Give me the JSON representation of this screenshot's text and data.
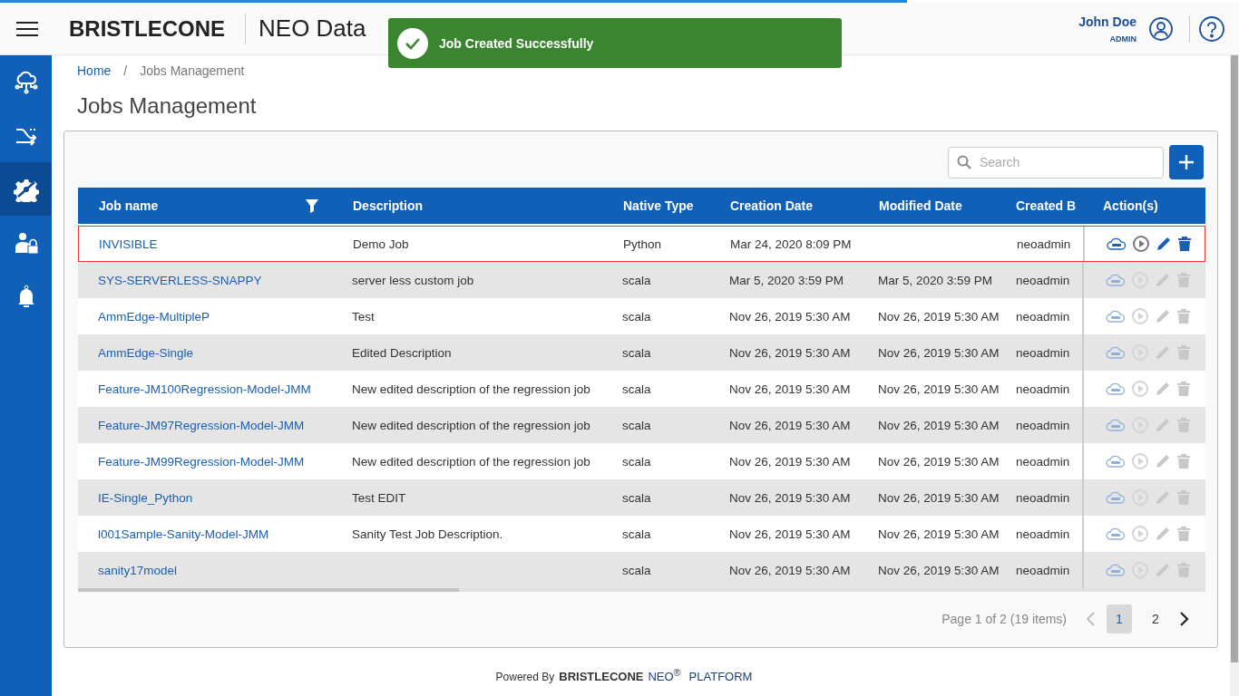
{
  "header": {
    "brand": "BRISTLECONE",
    "app_title": "NEO Data",
    "user": {
      "name": "John Doe",
      "role": "ADMIN"
    }
  },
  "toast": {
    "message": "Job Created Successfully"
  },
  "sidebar": {
    "items": [
      {
        "selected": false
      },
      {
        "selected": false
      },
      {
        "selected": true
      },
      {
        "selected": false
      },
      {
        "selected": false
      }
    ]
  },
  "breadcrumb": [
    {
      "label": "Home",
      "kind": "link"
    },
    {
      "label": "/",
      "kind": "separator"
    },
    {
      "label": "Jobs Management",
      "kind": "current"
    }
  ],
  "page_title": "Jobs Management",
  "search": {
    "placeholder": "Search"
  },
  "table": {
    "columns": [
      "Job name",
      "Description",
      "Native Type",
      "Creation Date",
      "Modified Date",
      "Created B",
      "Action(s)"
    ],
    "rows": [
      {
        "cells": [
          "INVISIBLE",
          "Demo Job",
          "Python",
          "Mar 24, 2020 8:09 PM",
          "",
          "neoadmin"
        ],
        "selected": true,
        "actions_disabled": false
      },
      {
        "cells": [
          "SYS-SERVERLESS-SNAPPY",
          "server less custom job",
          "scala",
          "Mar 5, 2020 3:59 PM",
          "Mar 5, 2020 3:59 PM",
          "neoadmin"
        ],
        "selected": false,
        "actions_disabled": true
      },
      {
        "cells": [
          "AmmEdge-MultipleP",
          "Test",
          "scala",
          "Nov 26, 2019 5:30 AM",
          "Nov 26, 2019 5:30 AM",
          "neoadmin"
        ],
        "selected": false,
        "actions_disabled": true
      },
      {
        "cells": [
          "AmmEdge-Single",
          "Edited Description",
          "scala",
          "Nov 26, 2019 5:30 AM",
          "Nov 26, 2019 5:30 AM",
          "neoadmin"
        ],
        "selected": false,
        "actions_disabled": true
      },
      {
        "cells": [
          "Feature-JM100Regression-Model-JMM",
          "New edited description of the regression job",
          "scala",
          "Nov 26, 2019 5:30 AM",
          "Nov 26, 2019 5:30 AM",
          "neoadmin"
        ],
        "selected": false,
        "actions_disabled": true
      },
      {
        "cells": [
          "Feature-JM97Regression-Model-JMM",
          "New edited description of the regression job",
          "scala",
          "Nov 26, 2019 5:30 AM",
          "Nov 26, 2019 5:30 AM",
          "neoadmin"
        ],
        "selected": false,
        "actions_disabled": true
      },
      {
        "cells": [
          "Feature-JM99Regression-Model-JMM",
          "New edited description of the regression job",
          "scala",
          "Nov 26, 2019 5:30 AM",
          "Nov 26, 2019 5:30 AM",
          "neoadmin"
        ],
        "selected": false,
        "actions_disabled": true
      },
      {
        "cells": [
          "IE-Single_Python",
          "Test EDIT",
          "scala",
          "Nov 26, 2019 5:30 AM",
          "Nov 26, 2019 5:30 AM",
          "neoadmin"
        ],
        "selected": false,
        "actions_disabled": true
      },
      {
        "cells": [
          "l001Sample-Sanity-Model-JMM",
          "Sanity Test Job Description.",
          "scala",
          "Nov 26, 2019 5:30 AM",
          "Nov 26, 2019 5:30 AM",
          "neoadmin"
        ],
        "selected": false,
        "actions_disabled": true
      },
      {
        "cells": [
          "sanity17model",
          "",
          "scala",
          "Nov 26, 2019 5:30 AM",
          "Nov 26, 2019 5:30 AM",
          "neoadmin"
        ],
        "selected": false,
        "actions_disabled": true
      }
    ]
  },
  "pagination": {
    "summary": "Page 1 of 2 (19 items)",
    "pages": [
      {
        "label": "1",
        "selected": true
      },
      {
        "label": "2",
        "selected": false
      }
    ]
  },
  "footer": {
    "powered_by": "Powered By",
    "brand": "BRISTLECONE",
    "product": "NEO$^{®}$",
    "suffix": "PLATFORM"
  }
}
